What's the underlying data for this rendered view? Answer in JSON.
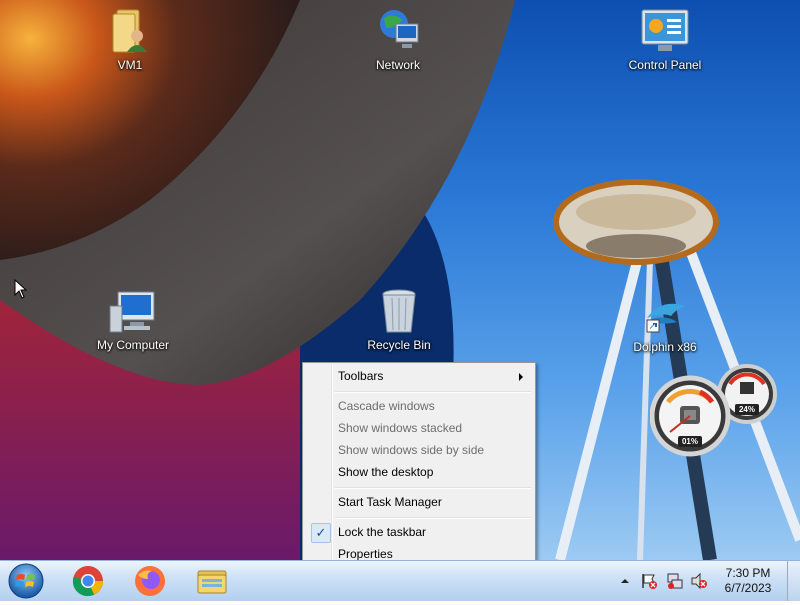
{
  "desktop": {
    "icons": [
      {
        "label": "VM1",
        "icon": "user-folder-icon"
      },
      {
        "label": "Network",
        "icon": "network-globe-icon"
      },
      {
        "label": "Control Panel",
        "icon": "control-panel-icon"
      },
      {
        "label": "My Computer",
        "icon": "computer-icon"
      },
      {
        "label": "Recycle Bin",
        "icon": "recycle-bin-icon"
      },
      {
        "label": "Dolphin x86",
        "icon": "dolphin-shortcut-icon"
      }
    ]
  },
  "context_menu": {
    "items": [
      {
        "label": "Toolbars",
        "state": "enabled",
        "submenu": true
      },
      {
        "label": "Cascade windows",
        "state": "disabled"
      },
      {
        "label": "Show windows stacked",
        "state": "disabled"
      },
      {
        "label": "Show windows side by side",
        "state": "disabled"
      },
      {
        "label": "Show the desktop",
        "state": "enabled"
      },
      {
        "label": "Start Task Manager",
        "state": "enabled"
      },
      {
        "label": "Lock the taskbar",
        "state": "enabled",
        "checked": true,
        "check_glyph": "✓"
      },
      {
        "label": "Properties",
        "state": "enabled"
      }
    ]
  },
  "gadget": {
    "cpu_label": "01%",
    "memory_label": "24%",
    "cpu_value": 1,
    "memory_value": 24
  },
  "taskbar": {
    "start_icon": "windows-orb-icon",
    "apps": [
      {
        "name": "chrome",
        "icon": "chrome-icon"
      },
      {
        "name": "firefox",
        "icon": "firefox-icon"
      },
      {
        "name": "explorer",
        "icon": "folder-icon"
      }
    ],
    "tray_icons": [
      "show-hidden-icons-arrow",
      "action-center-flag-icon",
      "network-icon",
      "volume-muted-icon"
    ],
    "clock": {
      "time": "7:30 PM",
      "date": "6/7/2023"
    }
  },
  "colors": {
    "menu_bg": "#f0f0f0",
    "disabled_text": "#6d6d6d",
    "taskbar": "#c8def5",
    "check_accent": "#1a4c94"
  }
}
